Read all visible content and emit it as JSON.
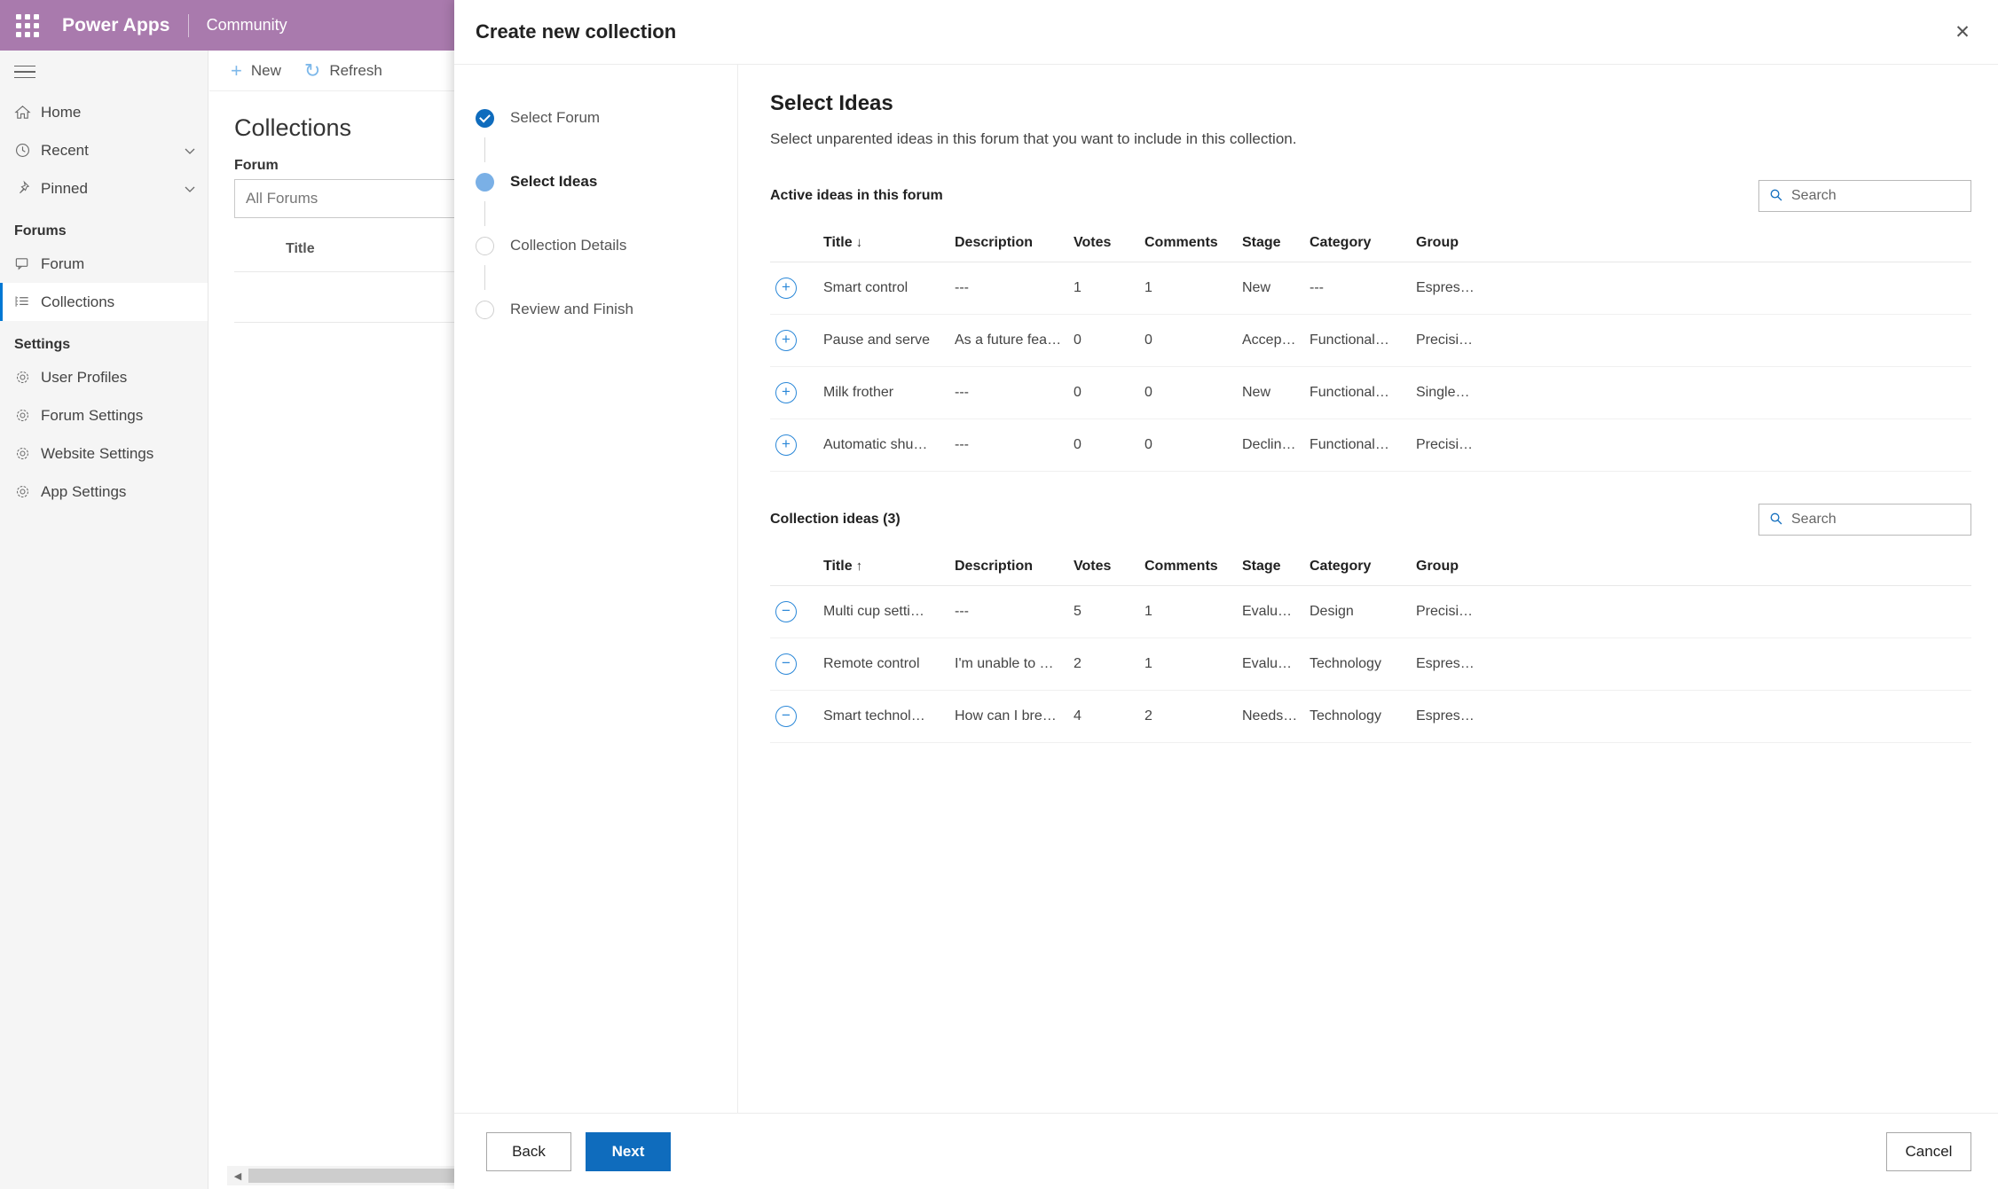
{
  "topbar": {
    "waffle_icon": "app-launcher-icon",
    "brand": "Power Apps",
    "subtitle": "Community"
  },
  "sidebar": {
    "items": [
      {
        "label": "Home",
        "icon": "home-icon",
        "chevron": ""
      },
      {
        "label": "Recent",
        "icon": "clock-icon",
        "chevron": "⌄"
      },
      {
        "label": "Pinned",
        "icon": "pin-icon",
        "chevron": "⌄"
      }
    ],
    "sections": [
      {
        "title": "Forums",
        "items": [
          {
            "label": "Forum",
            "icon": "forum-icon",
            "active": false
          },
          {
            "label": "Collections",
            "icon": "collections-icon",
            "active": true
          }
        ]
      },
      {
        "title": "Settings",
        "items": [
          {
            "label": "User Profiles",
            "icon": "gear-icon",
            "active": false
          },
          {
            "label": "Forum Settings",
            "icon": "gear-icon",
            "active": false
          },
          {
            "label": "Website Settings",
            "icon": "gear-icon",
            "active": false
          },
          {
            "label": "App Settings",
            "icon": "gear-icon",
            "active": false
          }
        ]
      }
    ]
  },
  "background_page": {
    "commands": [
      {
        "label": "New",
        "glyph": "+",
        "icon": "plus-icon"
      },
      {
        "label": "Refresh",
        "glyph": "↻",
        "icon": "refresh-icon"
      }
    ],
    "title": "Collections",
    "forum_field_label": "Forum",
    "forum_value": "All Forums",
    "table_header": "Title",
    "scroll_left_arrow": "◀"
  },
  "dialog": {
    "title": "Create new collection",
    "close_icon": "close-icon",
    "close_glyph": "✕",
    "steps": [
      {
        "label": "Select Forum",
        "state": "done"
      },
      {
        "label": "Select Ideas",
        "state": "current"
      },
      {
        "label": "Collection Details",
        "state": "todo"
      },
      {
        "label": "Review and Finish",
        "state": "todo"
      }
    ],
    "pane": {
      "heading": "Select Ideas",
      "subheading": "Select unparented ideas in this forum that you want to include in this collection.",
      "sections": [
        {
          "title": "Active ideas in this forum",
          "search_placeholder": "Search",
          "search_value": "",
          "sort_column": "Title",
          "sort_direction": "↓",
          "action_glyph": "+",
          "action_icon": "add-circle-icon",
          "columns": [
            "Title",
            "Description",
            "Votes",
            "Comments",
            "Stage",
            "Category",
            "Group"
          ],
          "rows": [
            {
              "title": "Smart control",
              "description": "---",
              "votes": "1",
              "comments": "1",
              "stage": "New",
              "category": "---",
              "group": "Espres…"
            },
            {
              "title": "Pause and serve",
              "description": "As a future fea…",
              "votes": "0",
              "comments": "0",
              "stage": "Accep…",
              "category": "Functional…",
              "group": "Precisi…"
            },
            {
              "title": "Milk frother",
              "description": "---",
              "votes": "0",
              "comments": "0",
              "stage": "New",
              "category": "Functional…",
              "group": "Single…"
            },
            {
              "title": "Automatic shu…",
              "description": "---",
              "votes": "0",
              "comments": "0",
              "stage": "Declin…",
              "category": "Functional…",
              "group": "Precisi…"
            }
          ]
        },
        {
          "title": "Collection ideas (3)",
          "search_placeholder": "Search",
          "search_value": "",
          "sort_column": "Title",
          "sort_direction": "↑",
          "action_glyph": "−",
          "action_icon": "remove-circle-icon",
          "columns": [
            "Title",
            "Description",
            "Votes",
            "Comments",
            "Stage",
            "Category",
            "Group"
          ],
          "rows": [
            {
              "title": "Multi cup setti…",
              "description": "---",
              "votes": "5",
              "comments": "1",
              "stage": "Evalua…",
              "category": "Design",
              "group": "Precisi…"
            },
            {
              "title": "Remote control",
              "description": "I'm unable to …",
              "votes": "2",
              "comments": "1",
              "stage": "Evalua…",
              "category": "Technology",
              "group": "Espres…"
            },
            {
              "title": "Smart technol…",
              "description": "How can I bre…",
              "votes": "4",
              "comments": "2",
              "stage": "Needs…",
              "category": "Technology",
              "group": "Espres…"
            }
          ]
        }
      ]
    },
    "footer": {
      "back_label": "Back",
      "next_label": "Next",
      "cancel_label": "Cancel"
    }
  },
  "colors": {
    "brand_purple": "#a97aad",
    "accent_blue": "#0f6cbd",
    "step_current": "#7ab0e6",
    "row_action": "#2b88d8"
  }
}
